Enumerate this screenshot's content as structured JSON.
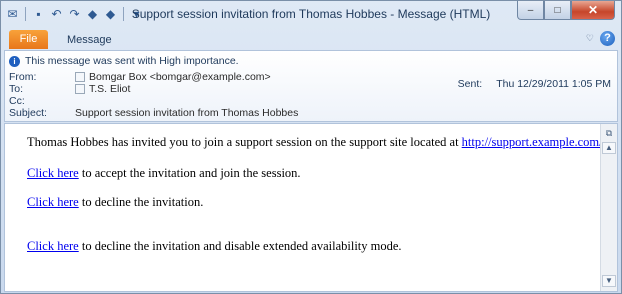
{
  "window": {
    "title": "Support session invitation from Thomas Hobbes  -  Message (HTML)",
    "controls": {
      "minimize": "–",
      "maximize": "□",
      "close": "✕"
    }
  },
  "qat": {
    "icons": [
      "outlook-icon",
      "save-icon",
      "undo-icon",
      "redo-icon",
      "up-arrow-icon",
      "down-arrow-icon",
      "customize-icon"
    ]
  },
  "ribbon": {
    "tabs": [
      {
        "label": "File"
      },
      {
        "label": "Message"
      }
    ],
    "collapse_glyph": "♡",
    "help_glyph": "?"
  },
  "header": {
    "notice": "This message was sent with High importance.",
    "from_label": "From:",
    "from_value": "Bomgar Box <bomgar@example.com>",
    "to_label": "To:",
    "to_value": "T.S. Eliot",
    "cc_label": "Cc:",
    "cc_value": "",
    "subject_label": "Subject:",
    "subject_value": "Support session invitation from Thomas Hobbes",
    "sent_label": "Sent:",
    "sent_value": "Thu 12/29/2011 1:05 PM"
  },
  "body": {
    "line1_text": "Thomas Hobbes has invited you to join a support session on the support site located at ",
    "line1_link": "http://support.example.com/",
    "line1_end": ".",
    "line2_link": "Click here",
    "line2_text": " to accept the invitation and join the session.",
    "line3_link": "Click here",
    "line3_text": " to decline the invitation.",
    "line4_link": "Click here",
    "line4_text": " to decline the invitation and disable extended availability mode."
  },
  "colors": {
    "file_tab": "#e8761a",
    "link": "#0000ee",
    "chrome": "#c9d9ee"
  }
}
